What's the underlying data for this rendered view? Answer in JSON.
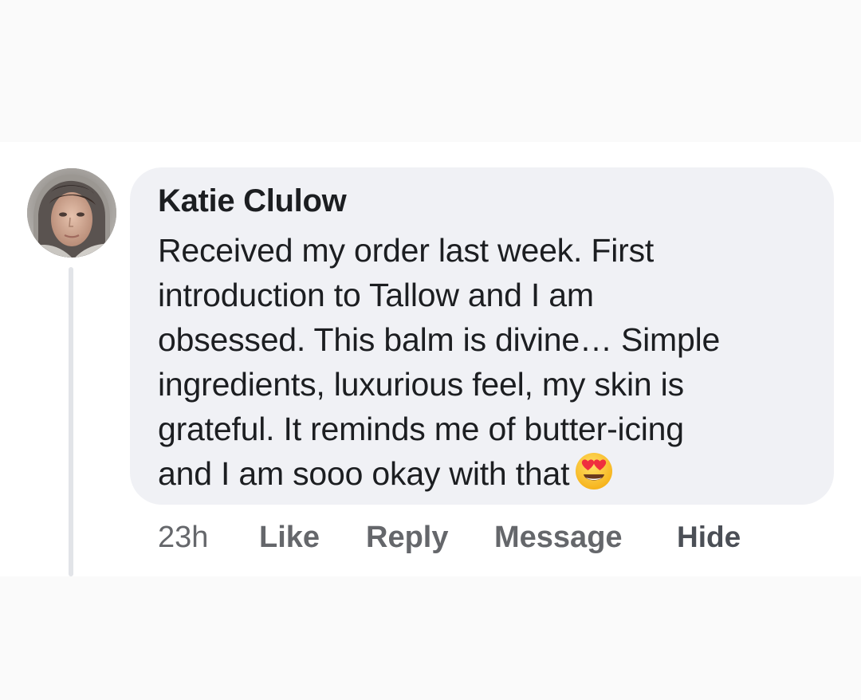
{
  "comment": {
    "author": "Katie Clulow",
    "text_lines": [
      "Received my order last week. First",
      "introduction to Tallow and I am",
      "obsessed. This balm is divine… Simple",
      "ingredients, luxurious feel, my skin is",
      "grateful. It reminds me of butter-icing",
      "and I am sooo okay with that"
    ],
    "emoji": "smiling-face-with-heart-eyes-icon",
    "avatar": "profile-photo-avatar"
  },
  "actions": {
    "time": "23h",
    "like": "Like",
    "reply": "Reply",
    "message": "Message",
    "hide": "Hide"
  },
  "colors": {
    "bubble_background": "#f0f1f5",
    "text_primary": "#1c1e21",
    "text_secondary": "#65676b",
    "thread_line": "#e2e4e8"
  }
}
